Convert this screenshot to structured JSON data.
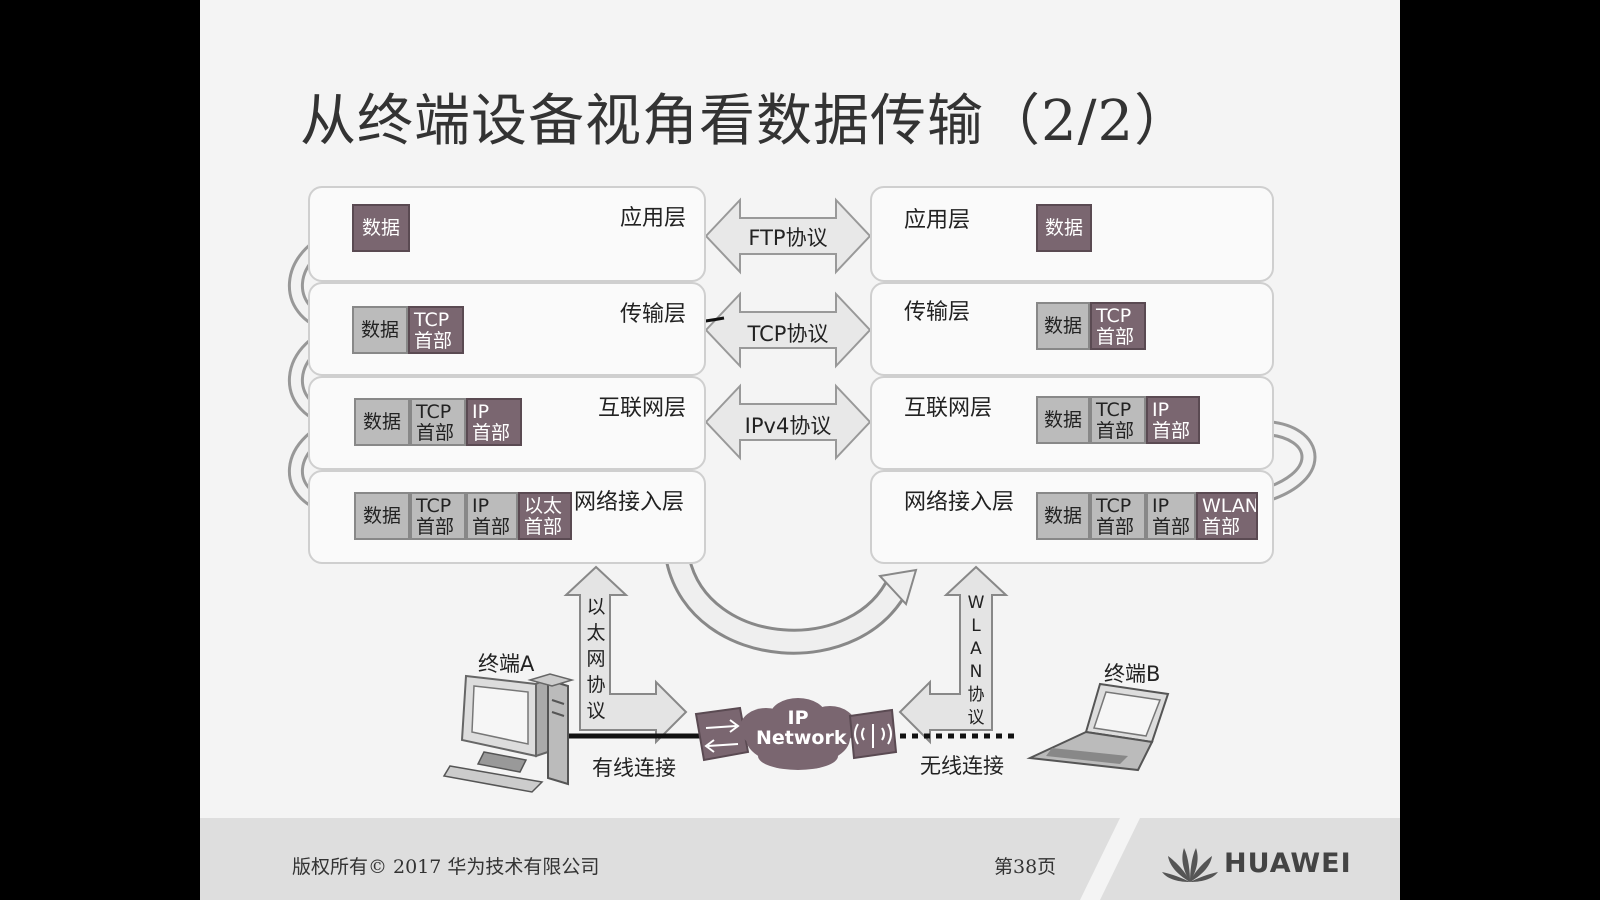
{
  "title": "从终端设备视角看数据传输（2/2）",
  "left_stack": {
    "layers": [
      {
        "name": "应用层"
      },
      {
        "name": "传输层"
      },
      {
        "name": "互联网层"
      },
      {
        "name": "网络接入层"
      }
    ],
    "blocks": {
      "app_data": "数据",
      "trans_data": "数据",
      "trans_tcp": "TCP\n首部",
      "net_data": "数据",
      "net_tcp": "TCP\n首部",
      "net_ip": "IP\n首部",
      "acc_data": "数据",
      "acc_tcp": "TCP\n首部",
      "acc_ip": "IP\n首部",
      "acc_eth": "以太\n首部"
    }
  },
  "right_stack": {
    "layers": [
      {
        "name": "应用层"
      },
      {
        "name": "传输层"
      },
      {
        "name": "互联网层"
      },
      {
        "name": "网络接入层"
      }
    ],
    "blocks": {
      "app_data": "数据",
      "trans_data": "数据",
      "trans_tcp": "TCP\n首部",
      "net_data": "数据",
      "net_tcp": "TCP\n首部",
      "net_ip": "IP\n首部",
      "acc_data": "数据",
      "acc_tcp": "TCP\n首部",
      "acc_ip": "IP\n首部",
      "acc_wlan": "WLAN\n首部"
    }
  },
  "protocols": [
    "FTP协议",
    "TCP协议",
    "IPv4协议"
  ],
  "bottom": {
    "ethernet_protocol": "以太网协议",
    "wlan_protocol": "WLAN协议",
    "terminal_a": "终端A",
    "terminal_b": "终端B",
    "wired": "有线连接",
    "wireless": "无线连接",
    "cloud_line1": "IP",
    "cloud_line2": "Network"
  },
  "footer": {
    "copyright": "版权所有© 2017 华为技术有限公司",
    "page": "第38页",
    "brand": "HUAWEI"
  },
  "colors": {
    "header_dark": "#7a6670",
    "header_light": "#bbbbbb",
    "layer_border": "#cfcfcf",
    "arrow_fill": "#e6e6e6",
    "arrow_stroke": "#888888"
  }
}
